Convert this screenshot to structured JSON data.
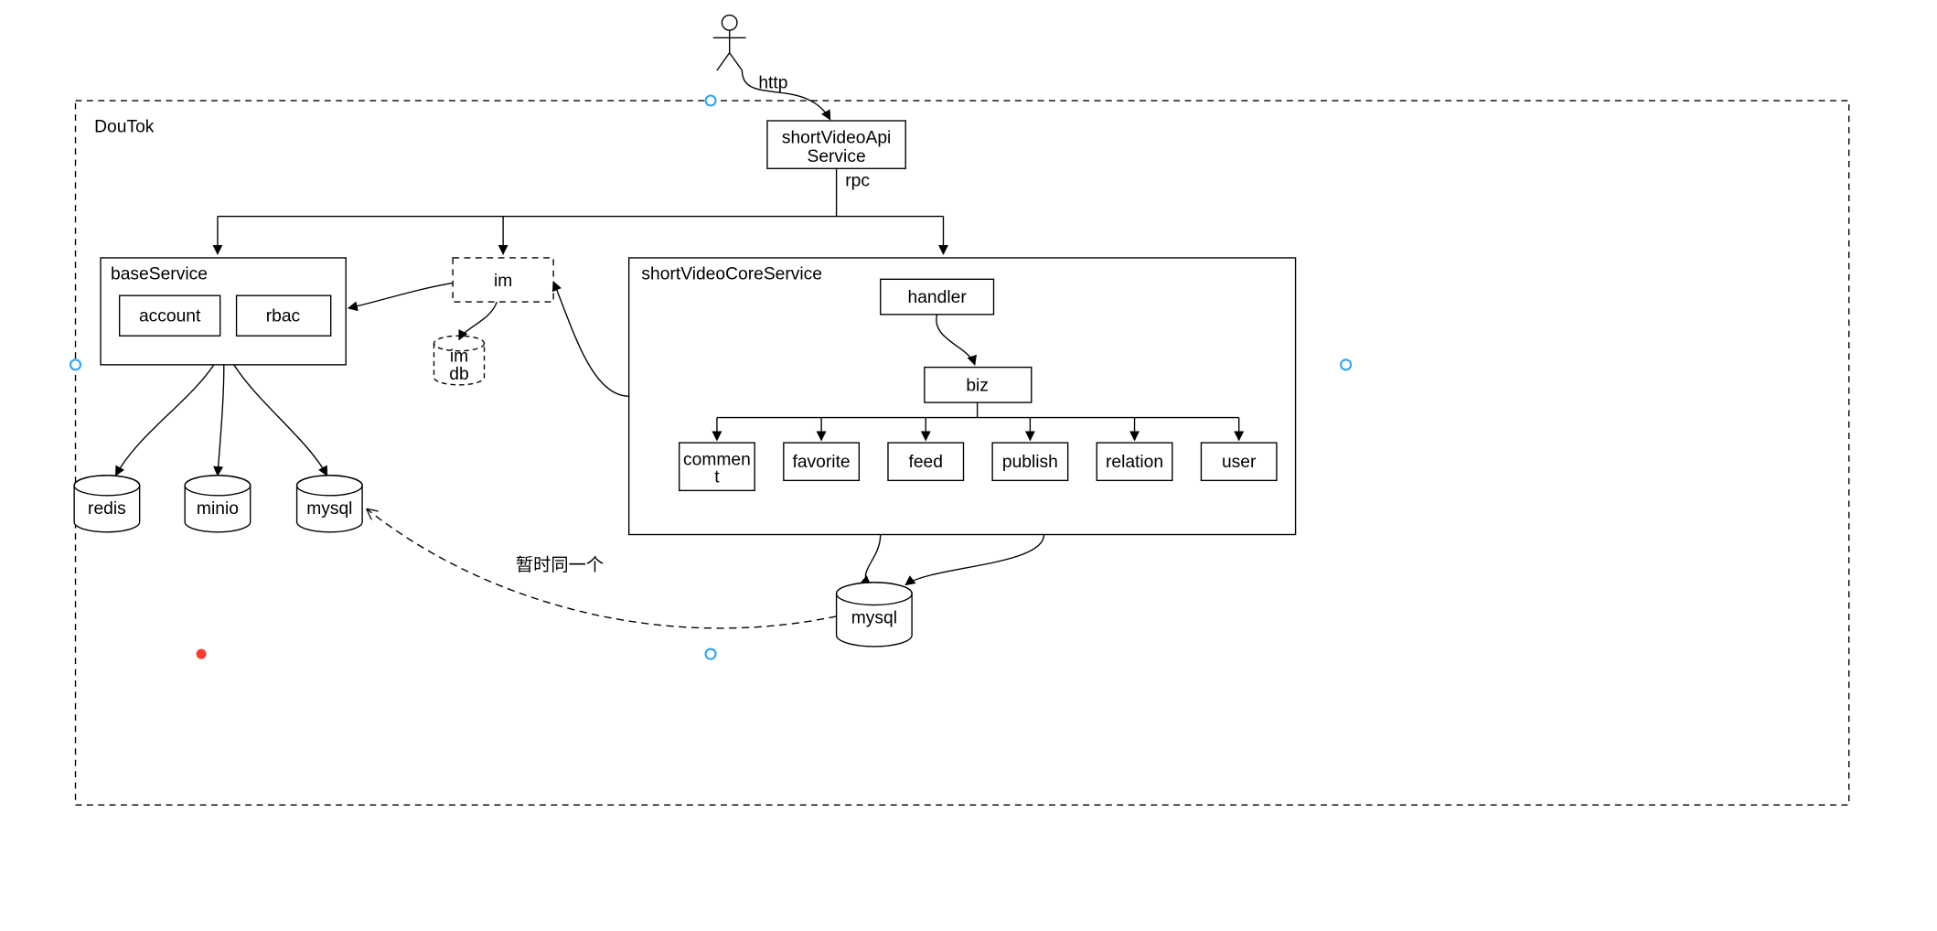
{
  "frame": {
    "title": "DouTok"
  },
  "actor": {
    "label_to_api": "http"
  },
  "api": {
    "name_line1": "shortVideoApi",
    "name_line2": "Service",
    "rpc_label": "rpc"
  },
  "baseService": {
    "title": "baseService",
    "account": "account",
    "rbac": "rbac"
  },
  "im": {
    "title": "im",
    "db": "im\ndb"
  },
  "core": {
    "title": "shortVideoCoreService",
    "handler": "handler",
    "biz": "biz",
    "modules": {
      "comment": "commen\nt",
      "favorite": "favorite",
      "feed": "feed",
      "publish": "publish",
      "relation": "relation",
      "user": "user"
    }
  },
  "stores": {
    "redis": "redis",
    "minio": "minio",
    "mysql_base": "mysql",
    "mysql_core": "mysql"
  },
  "notes": {
    "same_db": "暂时同一个"
  }
}
